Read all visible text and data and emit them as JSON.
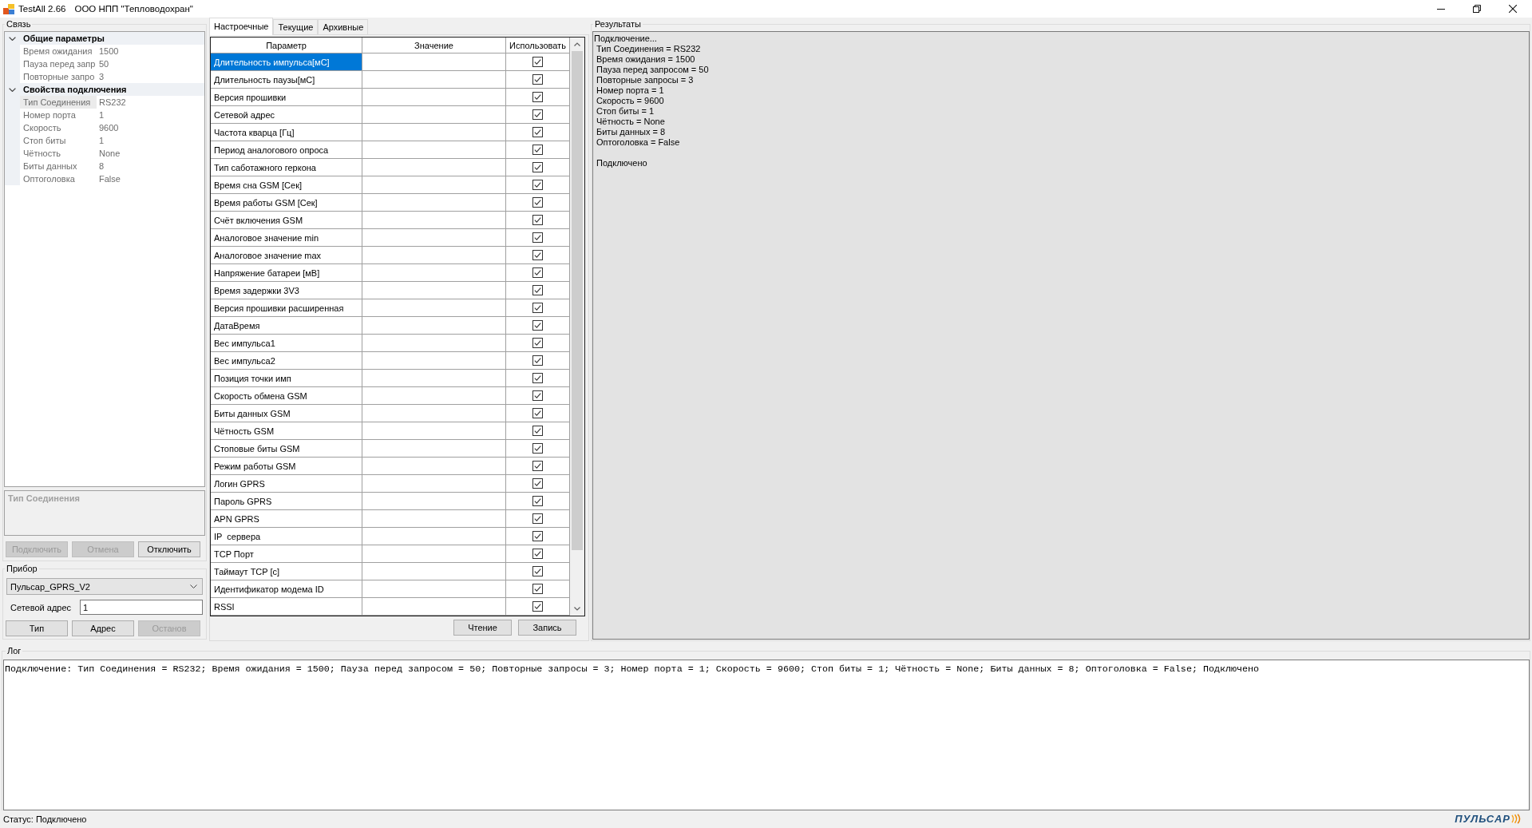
{
  "window": {
    "app_name": "TestAll 2.66",
    "company": "ООО НПП \"Тепловодохран\""
  },
  "connection": {
    "title": "Связь",
    "categories": [
      {
        "label": "Общие параметры",
        "expanded": true,
        "children": [
          {
            "name": "Время ожидания",
            "value": "1500",
            "selected": false
          },
          {
            "name": "Пауза перед запр",
            "value": "50",
            "selected": false
          },
          {
            "name": "Повторные запро",
            "value": "3",
            "selected": false
          }
        ]
      },
      {
        "label": "Свойства подключения",
        "expanded": true,
        "children": [
          {
            "name": "Тип Соединения",
            "value": "RS232",
            "selected": true
          },
          {
            "name": "Номер порта",
            "value": "1",
            "selected": false
          },
          {
            "name": "Скорость",
            "value": "9600",
            "selected": false
          },
          {
            "name": "Стоп биты",
            "value": "1",
            "selected": false
          },
          {
            "name": "Чётность",
            "value": "None",
            "selected": false
          },
          {
            "name": "Биты данных",
            "value": "8",
            "selected": false
          },
          {
            "name": "Оптоголовка",
            "value": "False",
            "selected": false
          }
        ]
      }
    ],
    "description": "Тип Соединения",
    "buttons": [
      {
        "label": "Подключить",
        "disabled": true
      },
      {
        "label": "Отмена",
        "disabled": true
      },
      {
        "label": "Отключить",
        "disabled": false
      }
    ]
  },
  "device": {
    "title": "Прибор",
    "model": "Пульсар_GPRS_V2",
    "address_label": "Сетевой адрес",
    "address": "1",
    "buttons": [
      {
        "label": "Тип",
        "disabled": false
      },
      {
        "label": "Адрес",
        "disabled": false
      },
      {
        "label": "Останов",
        "disabled": true
      }
    ]
  },
  "tabs": [
    {
      "label": "Настроечные",
      "selected": true
    },
    {
      "label": "Текущие",
      "selected": false
    },
    {
      "label": "Архивные",
      "selected": false
    }
  ],
  "table": {
    "columns": [
      "Параметр",
      "Значение",
      "Использовать"
    ],
    "rows": [
      {
        "param": "Длительность импульса[мС]",
        "checked": true,
        "selected": true
      },
      {
        "param": "Длительность паузы[мС]",
        "checked": true,
        "selected": false
      },
      {
        "param": "Версия прошивки",
        "checked": true,
        "selected": false
      },
      {
        "param": "Сетевой адрес",
        "checked": true,
        "selected": false
      },
      {
        "param": "Частота кварца [Гц]",
        "checked": true,
        "selected": false
      },
      {
        "param": "Период аналогового опроса",
        "checked": true,
        "selected": false
      },
      {
        "param": "Тип саботажного геркона",
        "checked": true,
        "selected": false
      },
      {
        "param": "Время сна GSM [Сек]",
        "checked": true,
        "selected": false
      },
      {
        "param": "Время работы GSM [Сек]",
        "checked": true,
        "selected": false
      },
      {
        "param": "Счёт включения GSM",
        "checked": true,
        "selected": false
      },
      {
        "param": "Аналоговое значение min",
        "checked": true,
        "selected": false
      },
      {
        "param": "Аналоговое значение max",
        "checked": true,
        "selected": false
      },
      {
        "param": "Напряжение батареи [мВ]",
        "checked": true,
        "selected": false
      },
      {
        "param": "Время задержки 3V3",
        "checked": true,
        "selected": false
      },
      {
        "param": "Версия прошивки расширенная",
        "checked": true,
        "selected": false
      },
      {
        "param": "ДатаВремя",
        "checked": true,
        "selected": false
      },
      {
        "param": "Вес импульса1",
        "checked": true,
        "selected": false
      },
      {
        "param": "Вес импульса2",
        "checked": true,
        "selected": false
      },
      {
        "param": "Позиция точки имп",
        "checked": true,
        "selected": false
      },
      {
        "param": "Скорость обмена GSM",
        "checked": true,
        "selected": false
      },
      {
        "param": "Биты данных GSM",
        "checked": true,
        "selected": false
      },
      {
        "param": "Чётность GSM",
        "checked": true,
        "selected": false
      },
      {
        "param": "Стоповые биты GSM",
        "checked": true,
        "selected": false
      },
      {
        "param": "Режим работы GSM",
        "checked": true,
        "selected": false
      },
      {
        "param": "Логин GPRS",
        "checked": true,
        "selected": false
      },
      {
        "param": "Пароль GPRS",
        "checked": true,
        "selected": false
      },
      {
        "param": "APN GPRS",
        "checked": true,
        "selected": false
      },
      {
        "param": "IP  сервера",
        "checked": true,
        "selected": false
      },
      {
        "param": "TCP Порт",
        "checked": true,
        "selected": false
      },
      {
        "param": "Таймаут TCP [с]",
        "checked": true,
        "selected": false
      },
      {
        "param": "Идентификатор модема ID",
        "checked": true,
        "selected": false
      },
      {
        "param": "RSSI",
        "checked": true,
        "selected": false
      }
    ],
    "actions": [
      "Чтение",
      "Запись"
    ]
  },
  "results": {
    "title": "Результаты",
    "heading": "Подключение...",
    "entries": [
      "Тип Соединения = RS232",
      "Время ожидания = 1500",
      "Пауза перед запросом = 50",
      "Повторные запросы = 3",
      "Номер порта = 1",
      "Скорость = 9600",
      "Стоп биты = 1",
      "Чётность = None",
      "Биты данных = 8",
      "Оптоголовка = False"
    ],
    "footer": "Подключено"
  },
  "log": {
    "title": "Лог",
    "text": "Подключение: Тип Соединения = RS232; Время ожидания = 1500; Пауза перед запросом = 50; Повторные запросы = 3; Номер порта = 1; Скорость = 9600; Стоп биты = 1; Чётность = None; Биты данных = 8; Оптоголовка = False; Подключено"
  },
  "status_bar": {
    "text": "Статус: Подключено",
    "logo": "ПУЛЬСАР"
  }
}
